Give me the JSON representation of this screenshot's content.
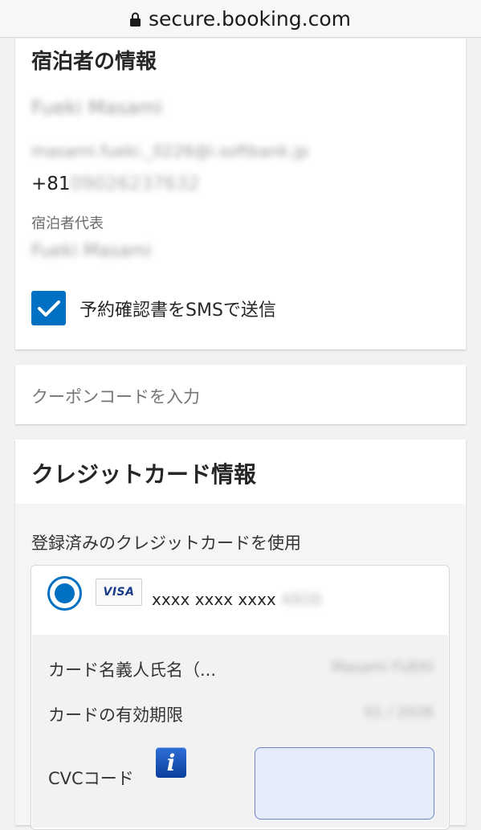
{
  "browser": {
    "url": "secure.booking.com",
    "icon": "lock-icon"
  },
  "guest": {
    "title": "宿泊者の情報",
    "name_obscured": "Fueki Masami",
    "email_obscured": "masami.fueki._0226@i.softbank.jp",
    "phone_prefix": "+81",
    "phone_obscured": "09026237632",
    "representative_label": "宿泊者代表",
    "representative_obscured": "Fueki Masami",
    "sms_checkbox": {
      "checked": true,
      "label": "予約確認書をSMSで送信"
    }
  },
  "coupon": {
    "placeholder": "クーポンコードを入力"
  },
  "credit_card": {
    "title": "クレジットカード情報",
    "saved_label": "登録済みのクレジットカードを使用",
    "selected": true,
    "brand": "VISA",
    "number_visible": "xxxx xxxx xxxx",
    "number_obscured": "4808",
    "holder_label": "カード名義人氏名（...",
    "holder_obscured": "Masami FUEKI",
    "expiry_label": "カードの有効期限",
    "expiry_obscured": "01 / 2026",
    "cvc_label": "CVCコード",
    "cvc_value": ""
  },
  "colors": {
    "accent": "#0071c2",
    "cvc_field_bg": "#e6ecfb"
  }
}
